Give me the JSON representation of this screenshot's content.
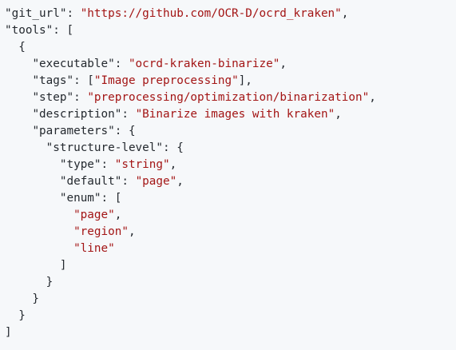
{
  "code": {
    "git_url_key": "\"git_url\"",
    "git_url_value": "\"https://github.com/OCR-D/ocrd_kraken\"",
    "tools_key": "\"tools\"",
    "executable_key": "\"executable\"",
    "executable_value": "\"ocrd-kraken-binarize\"",
    "tags_key": "\"tags\"",
    "tags_value": "\"Image preprocessing\"",
    "step_key": "\"step\"",
    "step_value": "\"preprocessing/optimization/binarization\"",
    "description_key": "\"description\"",
    "description_value": "\"Binarize images with kraken\"",
    "parameters_key": "\"parameters\"",
    "structure_level_key": "\"structure-level\"",
    "type_key": "\"type\"",
    "type_value": "\"string\"",
    "default_key": "\"default\"",
    "default_value": "\"page\"",
    "enum_key": "\"enum\"",
    "enum_values": [
      "\"page\"",
      "\"region\"",
      "\"line\""
    ]
  }
}
